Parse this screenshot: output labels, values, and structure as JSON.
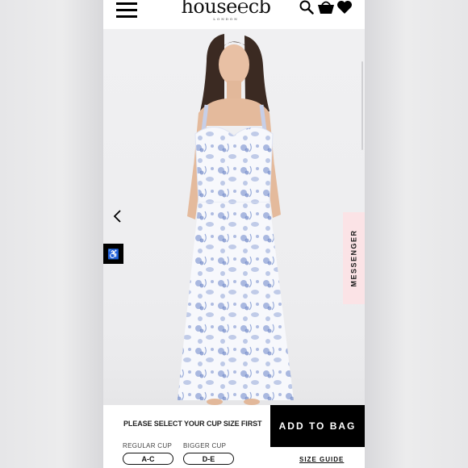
{
  "brand": {
    "logo_text": "house of cb",
    "logo_display": "house℮cb",
    "logo_sub": "LONDON"
  },
  "header": {
    "menu_icon": "hamburger-icon",
    "search_icon": "search-icon",
    "bag_icon": "shopping-bag-icon",
    "wishlist_icon": "heart-icon"
  },
  "gallery": {
    "prev_icon": "chevron-left-icon",
    "accessibility_icon": "accessibility-icon",
    "accessibility_glyph": "♿"
  },
  "messenger": {
    "label": "MESSENGER"
  },
  "purchase": {
    "cup_prompt": "PLEASE SELECT YOUR CUP SIZE FIRST",
    "add_to_bag_label": "ADD TO BAG",
    "cup_options": [
      {
        "group_label": "REGULAR CUP",
        "value": "A-C"
      },
      {
        "group_label": "BIGGER CUP",
        "value": "D-E"
      }
    ],
    "size_guide_label": "SIZE GUIDE"
  },
  "colors": {
    "accent": "#000000",
    "messenger_bg": "#fbe3e6",
    "dress_print": "#8ea3d6",
    "dress_base": "#f7f8fc"
  }
}
